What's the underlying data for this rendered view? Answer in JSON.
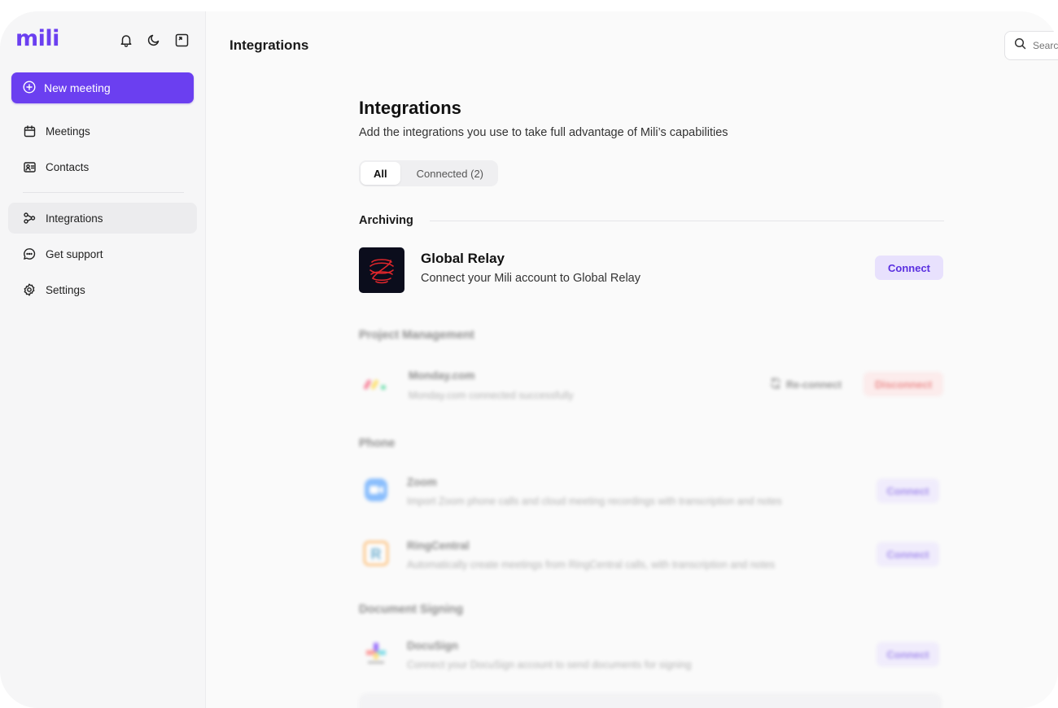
{
  "sidebar": {
    "logo": "mili",
    "new_meeting": "New meeting",
    "items": [
      {
        "label": "Meetings"
      },
      {
        "label": "Contacts"
      },
      {
        "label": "Integrations"
      },
      {
        "label": "Get support"
      },
      {
        "label": "Settings"
      }
    ]
  },
  "header": {
    "title": "Integrations",
    "search_placeholder": "Search"
  },
  "main": {
    "title": "Integrations",
    "subtitle": "Add the integrations you use to take full advantage of Mili’s capabilities",
    "tabs": [
      {
        "label": "All"
      },
      {
        "label": "Connected (2)"
      }
    ],
    "sections": {
      "archiving": {
        "title": "Archiving",
        "item": {
          "name": "Global Relay",
          "desc": "Connect your Mili account to Global Relay",
          "action": "Connect"
        }
      },
      "project_management": {
        "title": "Project Management",
        "item": {
          "name": "Monday.com",
          "desc": "Monday.com connected successfully",
          "reconnect": "Re-connect",
          "disconnect": "Disconnect"
        }
      },
      "phone": {
        "title": "Phone",
        "items": [
          {
            "name": "Zoom",
            "desc": "Import Zoom phone calls and cloud meeting recordings with transcription and notes",
            "action": "Connect"
          },
          {
            "name": "RingCentral",
            "desc": "Automatically create meetings from RingCentral calls, with transcription and notes",
            "action": "Connect"
          }
        ]
      },
      "document_signing": {
        "title": "Document Signing",
        "item": {
          "name": "DocuSign",
          "desc": "Connect your DocuSign account to send documents for signing",
          "action": "Connect"
        }
      }
    }
  },
  "colors": {
    "accent": "#6b3ff0",
    "connect_bg": "#e8e1fd",
    "disconnect_bg": "#fde0e0",
    "disconnect_text": "#e03434"
  }
}
